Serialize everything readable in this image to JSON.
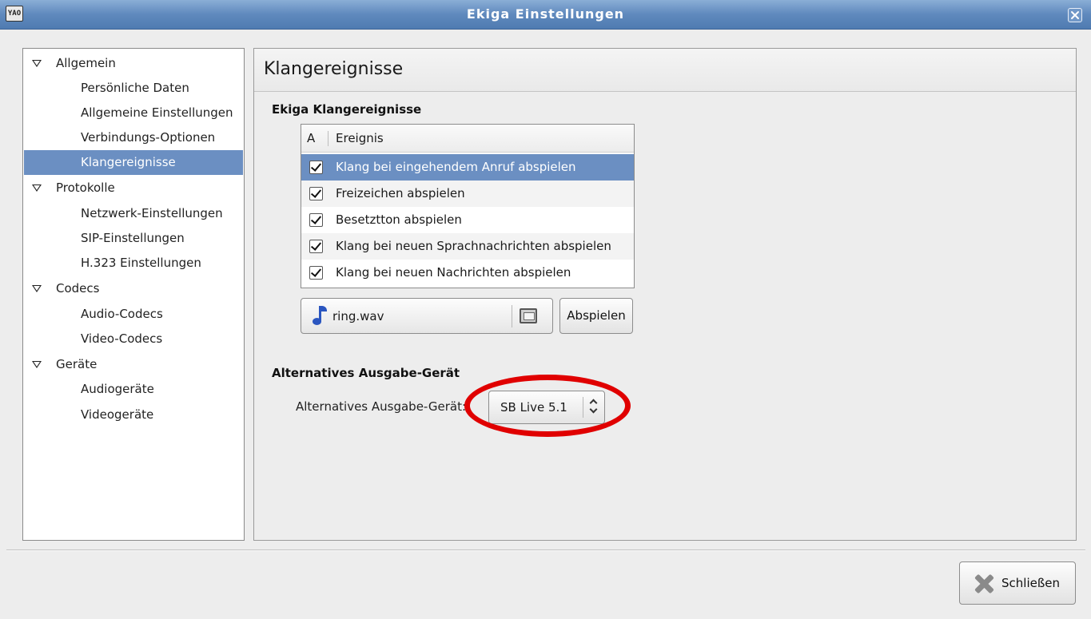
{
  "window": {
    "title": "Ekiga Einstellungen",
    "icon_text": "YAO",
    "close_icon": "close-icon"
  },
  "tree": {
    "items": [
      {
        "label": "Allgemein",
        "level": 0,
        "expanded": true
      },
      {
        "label": "Persönliche Daten",
        "level": 1
      },
      {
        "label": "Allgemeine Einstellungen",
        "level": 1
      },
      {
        "label": "Verbindungs-Optionen",
        "level": 1
      },
      {
        "label": "Klangereignisse",
        "level": 1,
        "selected": true
      },
      {
        "label": "Protokolle",
        "level": 0,
        "expanded": true
      },
      {
        "label": "Netzwerk-Einstellungen",
        "level": 1
      },
      {
        "label": "SIP-Einstellungen",
        "level": 1
      },
      {
        "label": "H.323 Einstellungen",
        "level": 1
      },
      {
        "label": "Codecs",
        "level": 0,
        "expanded": true
      },
      {
        "label": "Audio-Codecs",
        "level": 1
      },
      {
        "label": "Video-Codecs",
        "level": 1
      },
      {
        "label": "Geräte",
        "level": 0,
        "expanded": true
      },
      {
        "label": "Audiogeräte",
        "level": 1
      },
      {
        "label": "Videogeräte",
        "level": 1
      }
    ]
  },
  "panel": {
    "title": "Klangereignisse",
    "events_section": {
      "title": "Ekiga Klangereignisse",
      "columns": {
        "a": "A",
        "event": "Ereignis"
      },
      "rows": [
        {
          "label": "Klang bei eingehendem Anruf abspielen",
          "checked": true,
          "selected": true
        },
        {
          "label": "Freizeichen abspielen",
          "checked": true
        },
        {
          "label": "Besetztton abspielen",
          "checked": true
        },
        {
          "label": "Klang bei neuen Sprachnachrichten abspielen",
          "checked": true
        },
        {
          "label": "Klang bei neuen Nachrichten abspielen",
          "checked": true
        }
      ],
      "file_name": "ring.wav",
      "play_label": "Abspielen"
    },
    "output_section": {
      "title": "Alternatives Ausgabe-Gerät",
      "label": "Alternatives Ausgabe-Gerät:",
      "device_value": "SB Live 5.1"
    },
    "highlight_color": "#e00000"
  },
  "footer": {
    "close_label": "Schließen"
  },
  "colors": {
    "titlebar": "#5f89bd",
    "selection": "#6b8fc2"
  }
}
